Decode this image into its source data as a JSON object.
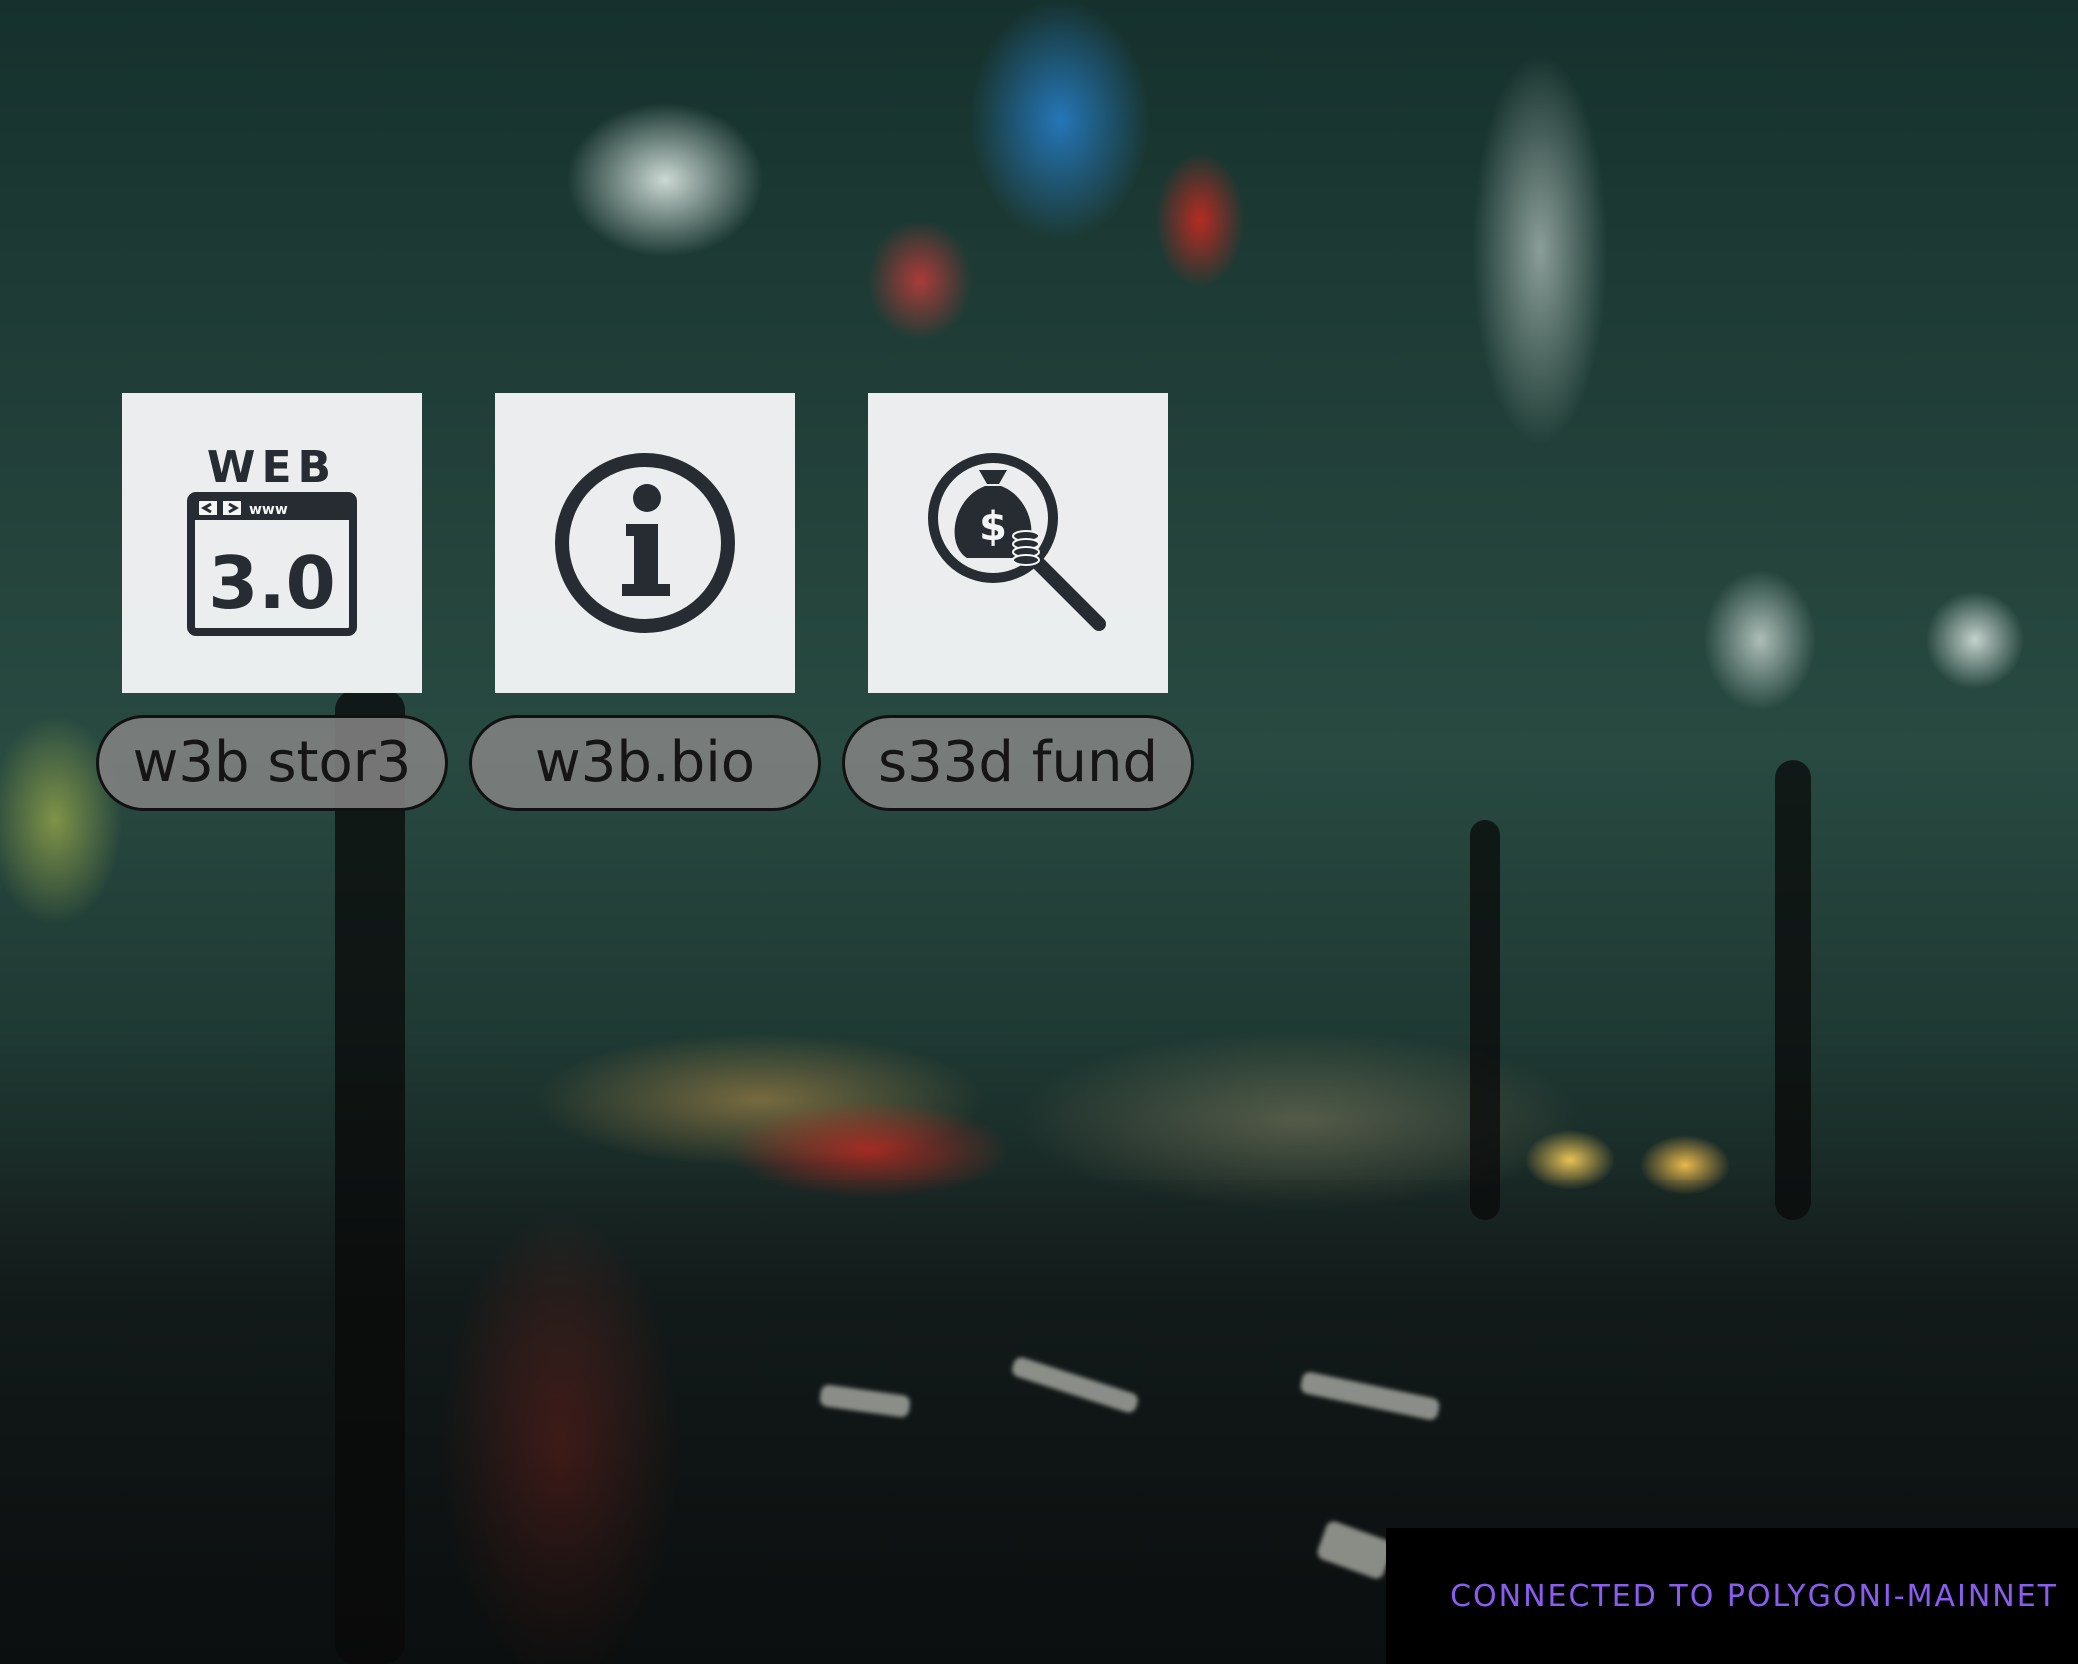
{
  "apps": [
    {
      "label": "w3b stor3",
      "icon": "web-3-0-icon"
    },
    {
      "label": "w3b.bio",
      "icon": "info-icon"
    },
    {
      "label": "s33d fund",
      "icon": "money-bag-search-icon"
    }
  ],
  "icon_text": {
    "web": "WEB",
    "www": "www",
    "version": "3.0",
    "info_letter": "i",
    "dollar": "$"
  },
  "status": {
    "text": "CONNECTED TO POLYGONI-MAINNET",
    "color": "#8a5cf0"
  },
  "colors": {
    "icon": "#262c31",
    "tile": "#f4f5f6",
    "label_bg": "#828282"
  }
}
